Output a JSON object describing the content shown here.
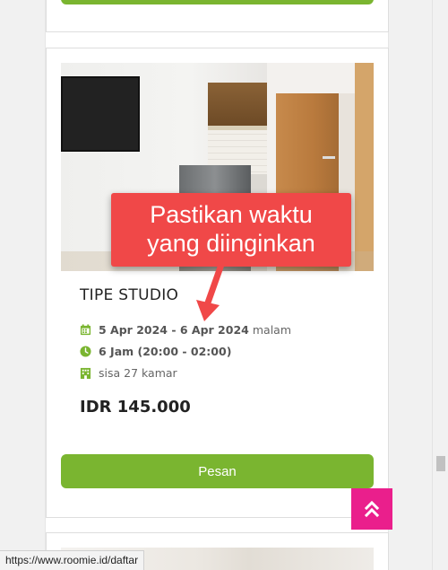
{
  "callout": {
    "line1": "Pastikan waktu",
    "line2": "yang diinginkan"
  },
  "room": {
    "title": "TIPE STUDIO",
    "date_range": "5 Apr 2024 - 6 Apr 2024",
    "date_suffix": "malam",
    "time": "6 Jam (20:00 - 02:00)",
    "availability": "sisa 27 kamar",
    "price": "IDR 145.000",
    "book_label": "Pesan",
    "icons": {
      "date": "calendar-icon",
      "time": "clock-icon",
      "rooms": "building-icon"
    }
  },
  "status_bar": {
    "url": "https://www.roomie.id/daftar"
  },
  "colors": {
    "primary_green": "#7ab530",
    "callout_red": "#f04848",
    "scroll_top_pink": "#ea1f8c"
  }
}
